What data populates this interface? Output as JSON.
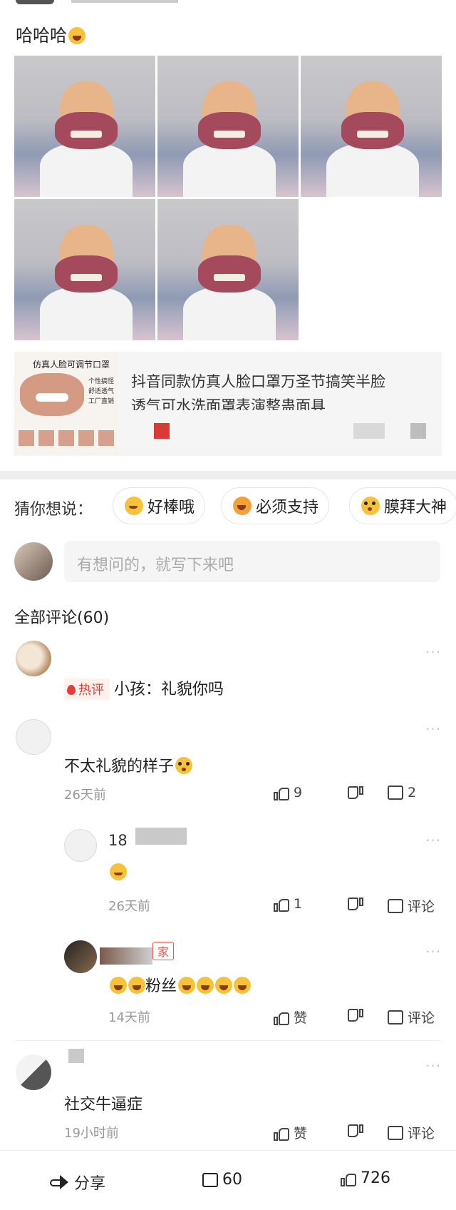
{
  "post": {
    "text": "哈哈哈"
  },
  "product": {
    "thumb_title": "仿真人脸可调节口罩",
    "thumb_bullets": [
      "个性搞怪",
      "舒适透气",
      "工厂直销"
    ],
    "title_line1": "抖音同款仿真人脸口罩万圣节搞笑半脸",
    "title_line2": "透气可水洗面罩表演整蛊面具"
  },
  "suggest": {
    "label": "猜你想说：",
    "chips": [
      "好棒哦",
      "必须支持",
      "膜拜大神"
    ]
  },
  "comment_input": {
    "placeholder": "有想问的，就写下来吧"
  },
  "comments_header": "全部评论(60)",
  "comments": [
    {
      "hot_badge": "热评",
      "text": "小孩：礼貌你吗"
    },
    {
      "text": "不太礼貌的样子",
      "time": "26天前",
      "likes": "9",
      "replies": "2"
    },
    {
      "username": "18",
      "time": "26天前",
      "likes": "1",
      "reply_label": "评论"
    },
    {
      "role_badge": "家",
      "text": "粉丝",
      "time": "14天前",
      "like_label": "赞",
      "reply_label": "评论"
    },
    {
      "text": "社交牛逼症",
      "time": "19小时前",
      "like_label": "赞",
      "reply_label": "评论"
    }
  ],
  "bottom_bar": {
    "share_label": "分享",
    "comment_count": "60",
    "like_count": "726"
  },
  "colors": {
    "accent": "#e33e3e",
    "hot_bg": "#fff1ec",
    "chip_border": "#e6e6e6"
  }
}
